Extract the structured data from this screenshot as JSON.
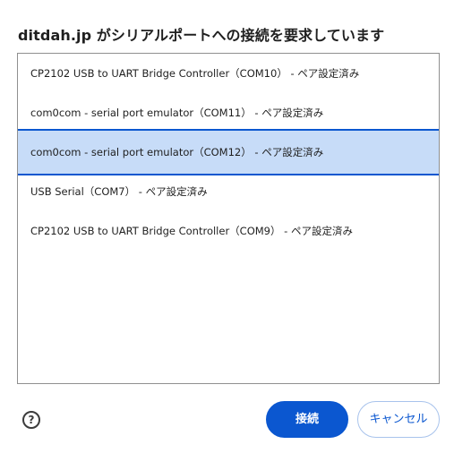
{
  "dialog": {
    "title": "ditdah.jp がシリアルポートへの接続を要求しています"
  },
  "ports": [
    {
      "label": "CP2102 USB to UART Bridge Controller（COM10） - ペア設定済み",
      "selected": false
    },
    {
      "label": "com0com - serial port emulator（COM11） - ペア設定済み",
      "selected": false
    },
    {
      "label": "com0com - serial port emulator（COM12） - ペア設定済み",
      "selected": true
    },
    {
      "label": "USB Serial（COM7） - ペア設定済み",
      "selected": false
    },
    {
      "label": "CP2102 USB to UART Bridge Controller（COM9） - ペア設定済み",
      "selected": false
    }
  ],
  "footer": {
    "help_glyph": "?",
    "connect_label": "接続",
    "cancel_label": "キャンセル"
  },
  "colors": {
    "accent": "#0b57d0",
    "selection_bg": "#c7dcf8"
  },
  "icons": {
    "help": "help-circle-icon"
  }
}
